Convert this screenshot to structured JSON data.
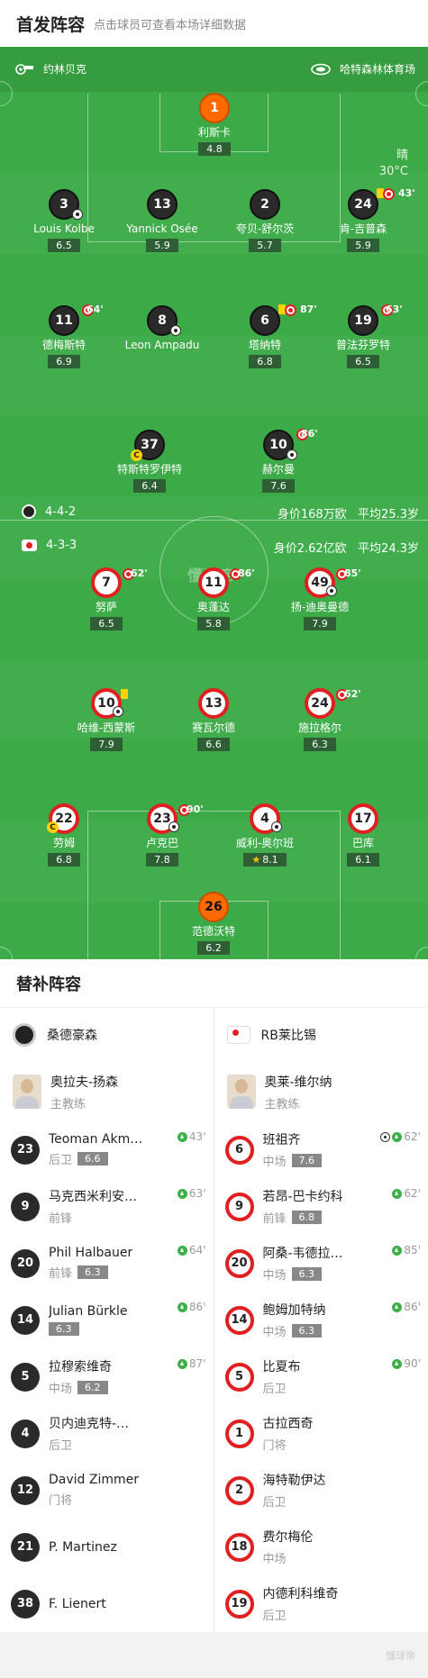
{
  "header": {
    "title": "首发阵容",
    "subtitle": "点击球员可查看本场详细数据"
  },
  "pitch": {
    "home_team": "约林贝克",
    "venue": "哈特森林体育场",
    "weather": "晴",
    "temp": "30°C",
    "watermark": "懂球帝",
    "home_info": {
      "formation": "4-4-2",
      "value": "身价168万欧",
      "age": "平均25.3岁"
    },
    "away_info": {
      "formation": "4-3-3",
      "value": "身价2.62亿欧",
      "age": "平均24.3岁"
    }
  },
  "home_players": [
    {
      "num": "1",
      "name": "利斯卡",
      "rating": "4.8"
    },
    {
      "num": "3",
      "name": "Louis Kolbe",
      "rating": "6.5"
    },
    {
      "num": "13",
      "name": "Yannick Osée",
      "rating": "5.9"
    },
    {
      "num": "2",
      "name": "夸贝-舒尔茨",
      "rating": "5.7"
    },
    {
      "num": "24",
      "name": "肯-吉普森",
      "rating": "5.9",
      "sub_time": "43'"
    },
    {
      "num": "11",
      "name": "德梅斯特",
      "rating": "6.9",
      "sub_time": "64'"
    },
    {
      "num": "8",
      "name": "Leon Ampadu",
      "rating": ""
    },
    {
      "num": "6",
      "name": "塔纳特",
      "rating": "6.8",
      "sub_time": "87'"
    },
    {
      "num": "19",
      "name": "普法芬罗特",
      "rating": "6.5",
      "sub_time": "63'"
    },
    {
      "num": "37",
      "name": "特斯特罗伊特",
      "rating": "6.4"
    },
    {
      "num": "10",
      "name": "赫尔曼",
      "rating": "7.6",
      "sub_time": "86'"
    }
  ],
  "away_players": [
    {
      "num": "7",
      "name": "努萨",
      "rating": "6.5",
      "sub_time": "62'"
    },
    {
      "num": "11",
      "name": "奥蓬达",
      "rating": "5.8",
      "sub_time": "86'"
    },
    {
      "num": "49",
      "name": "扬-迪奥曼德",
      "rating": "7.9",
      "sub_time": "85'"
    },
    {
      "num": "10",
      "name": "哈维-西蒙斯",
      "rating": "7.9"
    },
    {
      "num": "13",
      "name": "赛瓦尔德",
      "rating": "6.6"
    },
    {
      "num": "24",
      "name": "施拉格尔",
      "rating": "6.3",
      "sub_time": "62'"
    },
    {
      "num": "22",
      "name": "劳姆",
      "rating": "6.8"
    },
    {
      "num": "23",
      "name": "卢克巴",
      "rating": "7.8",
      "sub_time": "90'"
    },
    {
      "num": "4",
      "name": "威利-奥尔班",
      "rating": "8.1"
    },
    {
      "num": "17",
      "name": "巴库",
      "rating": "6.1"
    },
    {
      "num": "26",
      "name": "范德沃特",
      "rating": "6.2"
    }
  ],
  "subs": {
    "title": "替补阵容",
    "home": {
      "team": "桑德豪森",
      "coach": {
        "name": "奥拉夫-扬森",
        "role": "主教练"
      },
      "players": [
        {
          "num": "23",
          "name": "Teoman Akm…",
          "pos": "后卫",
          "rating": "6.6",
          "min": "43'"
        },
        {
          "num": "9",
          "name": "马克西米利安…",
          "pos": "前锋",
          "rating": "",
          "min": "63'"
        },
        {
          "num": "20",
          "name": "Phil Halbauer",
          "pos": "前锋",
          "rating": "6.3",
          "min": "64'"
        },
        {
          "num": "14",
          "name": "Julian Bürkle",
          "pos": "",
          "rating": "6.3",
          "min": "86'"
        },
        {
          "num": "5",
          "name": "拉穆索维奇",
          "pos": "中场",
          "rating": "6.2",
          "min": "87'"
        },
        {
          "num": "4",
          "name": "贝内迪克特-…",
          "pos": "后卫",
          "rating": "",
          "min": ""
        },
        {
          "num": "12",
          "name": "David Zimmer",
          "pos": "门将",
          "rating": "",
          "min": ""
        },
        {
          "num": "21",
          "name": "P. Martinez",
          "pos": "",
          "rating": "",
          "min": ""
        },
        {
          "num": "38",
          "name": "F. Lienert",
          "pos": "",
          "rating": "",
          "min": ""
        }
      ]
    },
    "away": {
      "team": "RB莱比锡",
      "coach": {
        "name": "奥莱-维尔纳",
        "role": "主教练"
      },
      "players": [
        {
          "num": "6",
          "name": "班祖齐",
          "pos": "中场",
          "rating": "7.6",
          "min": "62'"
        },
        {
          "num": "9",
          "name": "若昂-巴卡约科",
          "pos": "前锋",
          "rating": "6.8",
          "min": "62'"
        },
        {
          "num": "20",
          "name": "阿桑-韦德拉…",
          "pos": "中场",
          "rating": "6.3",
          "min": "85'"
        },
        {
          "num": "14",
          "name": "鲍姆加特纳",
          "pos": "中场",
          "rating": "6.3",
          "min": "86'"
        },
        {
          "num": "5",
          "name": "比夏布",
          "pos": "后卫",
          "rating": "",
          "min": "90'"
        },
        {
          "num": "1",
          "name": "古拉西奇",
          "pos": "门将",
          "rating": "",
          "min": ""
        },
        {
          "num": "2",
          "name": "海特勒伊达",
          "pos": "后卫",
          "rating": "",
          "min": ""
        },
        {
          "num": "18",
          "name": "费尔梅伦",
          "pos": "中场",
          "rating": "",
          "min": ""
        },
        {
          "num": "19",
          "name": "内德利科维奇",
          "pos": "后卫",
          "rating": "",
          "min": ""
        }
      ]
    }
  },
  "footer": {
    "watermark": "懂球帝"
  }
}
